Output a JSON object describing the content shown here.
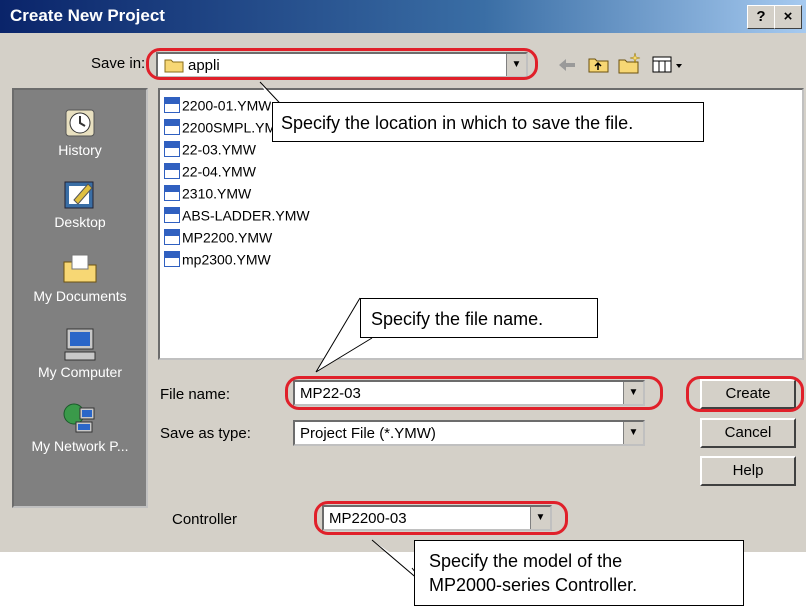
{
  "dialog": {
    "title": "Create New Project",
    "help_btn": "?",
    "close_btn": "×"
  },
  "save_in": {
    "label": "Save in:",
    "folder": "appli"
  },
  "toolbar": {
    "icons": [
      "back-arrow-icon",
      "up-folder-icon",
      "new-folder-icon",
      "view-menu-icon"
    ]
  },
  "places": [
    {
      "label": "History",
      "icon": "history-icon"
    },
    {
      "label": "Desktop",
      "icon": "desktop-icon"
    },
    {
      "label": "My Documents",
      "icon": "my-documents-icon"
    },
    {
      "label": "My Computer",
      "icon": "my-computer-icon"
    },
    {
      "label": "My Network P...",
      "icon": "my-network-icon"
    }
  ],
  "files": [
    "2200-01.YMW",
    "2200SMPL.YMW",
    "22-03.YMW",
    "22-04.YMW",
    "2310.YMW",
    "ABS-LADDER.YMW",
    "MP2200.YMW",
    "mp2300.YMW"
  ],
  "form": {
    "file_name_label": "File name:",
    "file_name_value": "MP22-03",
    "save_type_label": "Save as type:",
    "save_type_value": "Project File (*.YMW)",
    "controller_label": "Controller",
    "controller_value": "MP2200-03"
  },
  "buttons": {
    "create": "Create",
    "cancel": "Cancel",
    "help": "Help"
  },
  "callouts": {
    "location": "Specify the location in which to save the file.",
    "file_name": "Specify the file name.",
    "model_line1": "Specify the model of the",
    "model_line2": "MP2000-series Controller."
  },
  "colors": {
    "highlight": "#e0202a",
    "titlebar": "#0a246a",
    "dialog_bg": "#d4d0c8"
  }
}
